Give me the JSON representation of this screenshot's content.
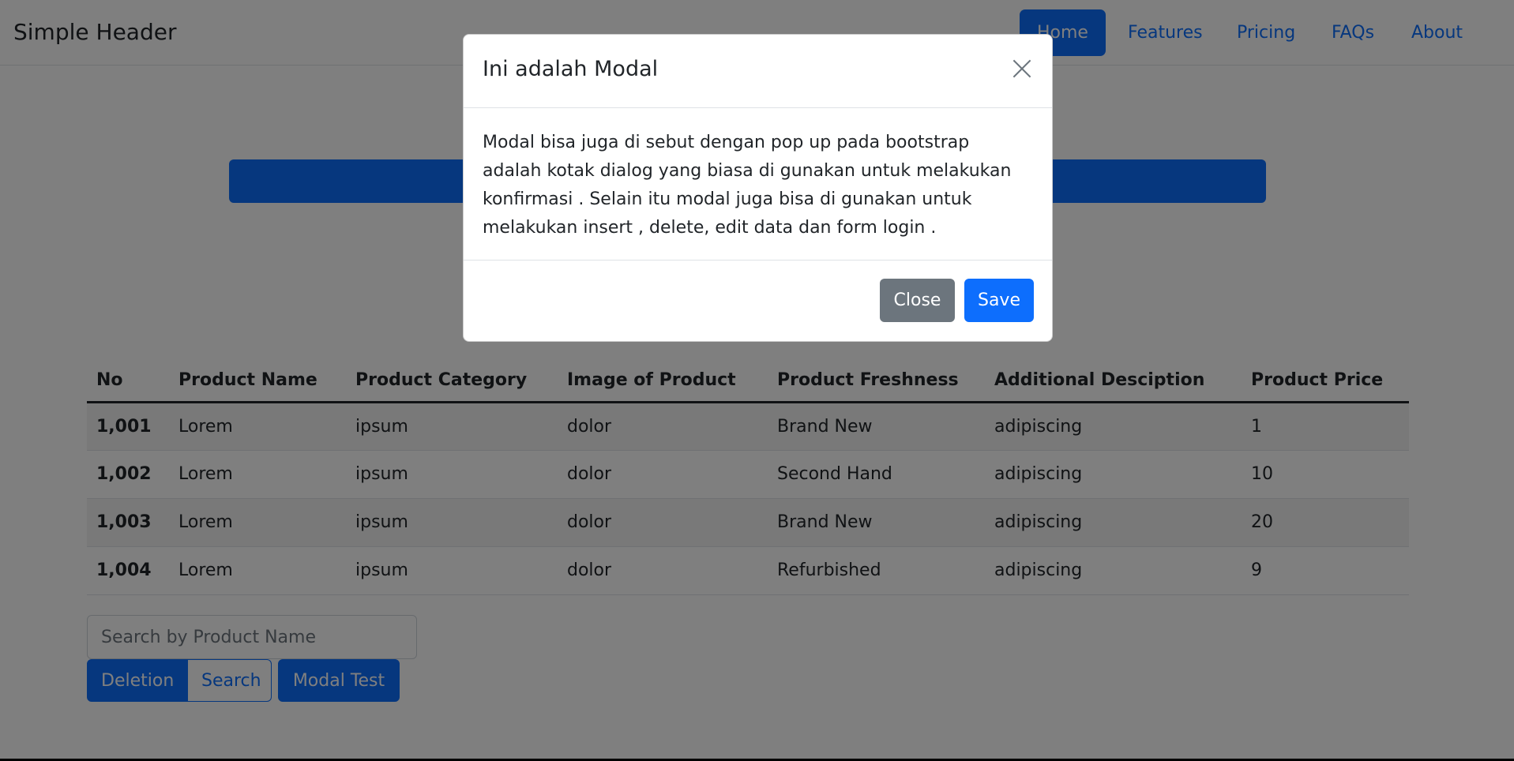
{
  "header": {
    "title": "Simple Header",
    "nav": [
      {
        "label": "Home",
        "active": true
      },
      {
        "label": "Features"
      },
      {
        "label": "Pricing"
      },
      {
        "label": "FAQs"
      },
      {
        "label": "About"
      }
    ]
  },
  "table": {
    "columns": [
      "No",
      "Product Name",
      "Product Category",
      "Image of Product",
      "Product Freshness",
      "Additional Desciption",
      "Product Price"
    ],
    "rows": [
      [
        "1,001",
        "Lorem",
        "ipsum",
        "dolor",
        "Brand New",
        "adipiscing",
        "1"
      ],
      [
        "1,002",
        "Lorem",
        "ipsum",
        "dolor",
        "Second Hand",
        "adipiscing",
        "10"
      ],
      [
        "1,003",
        "Lorem",
        "ipsum",
        "dolor",
        "Brand New",
        "adipiscing",
        "20"
      ],
      [
        "1,004",
        "Lorem",
        "ipsum",
        "dolor",
        "Refurbished",
        "adipiscing",
        "9"
      ]
    ]
  },
  "search": {
    "placeholder": "Search by Product Name",
    "value": ""
  },
  "buttons": {
    "deletion": "Deletion",
    "search": "Search",
    "modal_test": "Modal Test"
  },
  "modal": {
    "title": "Ini adalah Modal",
    "body": "Modal bisa juga di sebut dengan pop up pada bootstrap adalah kotak dialog yang biasa di gunakan untuk melakukan konfirmasi . Selain itu modal juga bisa di gunakan untuk melakukan insert , delete, edit data dan form login .",
    "close_label": "Close",
    "save_label": "Save"
  },
  "colors": {
    "primary": "#0d6efd",
    "secondary": "#6c757d",
    "backdrop": "rgba(0,0,0,0.5)"
  }
}
